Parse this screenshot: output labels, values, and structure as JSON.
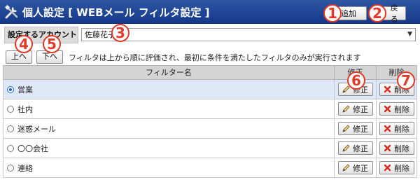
{
  "header": {
    "title": "個人設定 [ WEBメール  フィルタ設定 ]",
    "add_label": "追加",
    "back_label": "戻る"
  },
  "account": {
    "label": "設定するアカウント",
    "selected": "佐藤花子"
  },
  "order": {
    "up_label": "上へ",
    "down_label": "下へ",
    "note": "フィルタは上から順に評価され、最初に条件を満たしたフィルタのみが実行されます"
  },
  "table": {
    "headers": {
      "name": "フィルター名",
      "edit": "修正",
      "delete": "削除"
    },
    "rows": [
      {
        "name": "営業",
        "selected": true,
        "edit_label": "修正",
        "delete_label": "削除"
      },
      {
        "name": "社内",
        "selected": false,
        "edit_label": "修正",
        "delete_label": "削除"
      },
      {
        "name": "迷惑メール",
        "selected": false,
        "edit_label": "修正",
        "delete_label": "削除"
      },
      {
        "name": "〇〇会社",
        "selected": false,
        "edit_label": "修正",
        "delete_label": "削除"
      },
      {
        "name": "連絡",
        "selected": false,
        "edit_label": "修正",
        "delete_label": "削除"
      }
    ]
  },
  "callouts": [
    "1",
    "2",
    "3",
    "4",
    "5",
    "6",
    "7"
  ],
  "colors": {
    "header_bg": "#1f4796",
    "callout": "#e23a2a",
    "selected_row": "#dfe8f8",
    "delete_x": "#d42a1f",
    "add_plus": "#2fa33a"
  },
  "icons": {
    "header": "tools-icon",
    "add": "add-icon",
    "back": "back-icon",
    "edit": "pencil-icon",
    "delete": "delete-x-icon"
  }
}
